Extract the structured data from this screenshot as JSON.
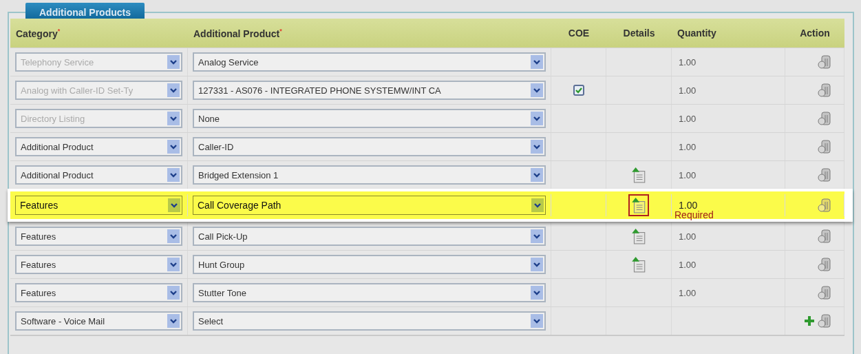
{
  "section_tab": "Additional Products",
  "columns": [
    "Category$^{*}$",
    "Additional Product$^{*}$",
    "COE",
    "Details",
    "Quantity",
    "Action"
  ],
  "rows": [
    {
      "category": "Telephony Service",
      "category_disabled": true,
      "product": "Analog Service",
      "details": false,
      "quantity": "1.00",
      "selected": false
    },
    {
      "category": "Analog with Caller-ID Set-Ty",
      "category_disabled": true,
      "product": "127331 - AS076 - INTEGRATED PHONE SYSTEMW/INT CA",
      "coe_checkbox": {
        "checked": true
      },
      "details": false,
      "quantity": "1.00",
      "selected": false
    },
    {
      "category": "Directory Listing",
      "category_disabled": true,
      "product": "None",
      "details": false,
      "quantity": "1.00",
      "selected": false
    },
    {
      "category": "Additional Product",
      "category_disabled": false,
      "product": "Caller-ID",
      "details": false,
      "quantity": "1.00",
      "selected": false
    },
    {
      "category": "Additional Product",
      "category_disabled": false,
      "product": "Bridged Extension 1",
      "details": true,
      "quantity": "1.00",
      "selected": false
    },
    {
      "category": "Features",
      "category_disabled": false,
      "product": "Call Coverage Path",
      "details": true,
      "quantity": "1.00",
      "note": "Required",
      "selected": true
    },
    {
      "category": "Features",
      "category_disabled": false,
      "product": "Call Pick-Up",
      "details": true,
      "quantity": "1.00",
      "selected": false
    },
    {
      "category": "Features",
      "category_disabled": false,
      "product": "Hunt Group",
      "details": true,
      "quantity": "1.00",
      "selected": false
    },
    {
      "category": "Features",
      "category_disabled": false,
      "product": "Stutter Tone",
      "details": false,
      "quantity": "1.00",
      "selected": false
    },
    {
      "category": "Software - Voice Mail",
      "category_disabled": false,
      "product": "Select",
      "details": false,
      "add_button": true,
      "selected": false
    }
  ]
}
